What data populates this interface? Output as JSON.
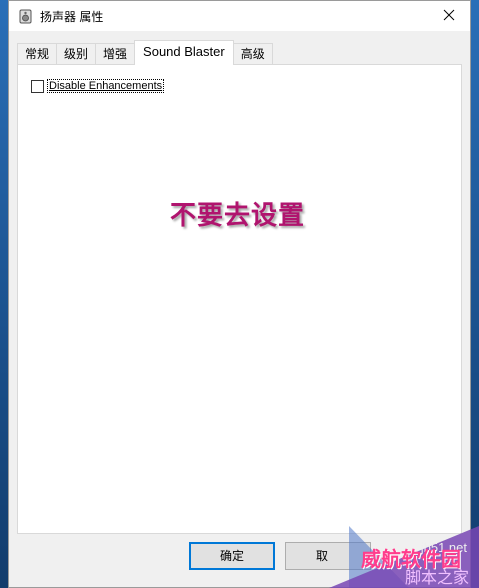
{
  "window": {
    "title": "扬声器 属性",
    "close_glyph": "✕"
  },
  "tabs": [
    {
      "label": "常规",
      "active": false
    },
    {
      "label": "级别",
      "active": false
    },
    {
      "label": "增强",
      "active": false
    },
    {
      "label": "Sound Blaster",
      "active": true
    },
    {
      "label": "高级",
      "active": false
    }
  ],
  "panel": {
    "checkbox_label": "Disable Enhancements",
    "checkbox_checked": false,
    "annotation": "不要去设置"
  },
  "buttons": {
    "ok_label": "确定",
    "cancel_label": "取"
  },
  "watermark": {
    "brand": "威航软件园",
    "site": "jb51.net",
    "subtitle": "脚本之家"
  },
  "colors": {
    "annotation": "#b0146e",
    "accent": "#0078d7",
    "desktop": "#1f5a99"
  }
}
